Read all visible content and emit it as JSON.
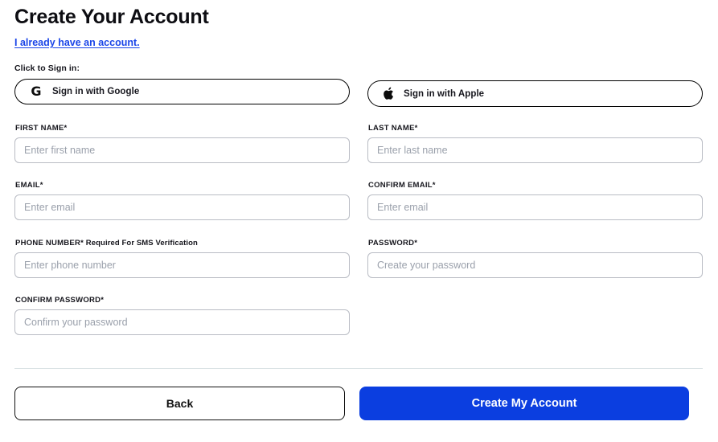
{
  "header": {
    "title": "Create Your Account",
    "existing_account_link": "I already have an account.",
    "signin_caption": "Click to Sign in:"
  },
  "social": {
    "google": {
      "label": "Sign in with Google",
      "icon": "google-g-icon",
      "glyph": "G"
    },
    "apple": {
      "label": "Sign in with Apple",
      "icon": "apple-logo-icon"
    }
  },
  "form": {
    "fields": [
      {
        "key": "first_name",
        "label": "FIRST NAME*",
        "note": "",
        "placeholder": "Enter first name",
        "value": "",
        "type": "text",
        "column": "left",
        "row": 1
      },
      {
        "key": "last_name",
        "label": "LAST NAME*",
        "note": "",
        "placeholder": "Enter last name",
        "value": "",
        "type": "text",
        "column": "right",
        "row": 1
      },
      {
        "key": "email",
        "label": "EMAIL*",
        "note": "",
        "placeholder": "Enter email",
        "value": "",
        "type": "text",
        "column": "left",
        "row": 2
      },
      {
        "key": "confirm_email",
        "label": "CONFIRM EMAIL*",
        "note": "",
        "placeholder": "Enter email",
        "value": "",
        "type": "text",
        "column": "right",
        "row": 2
      },
      {
        "key": "phone_number",
        "label": "PHONE NUMBER*",
        "note": " Required For SMS Verification",
        "placeholder": "Enter phone number",
        "value": "",
        "type": "text",
        "column": "left",
        "row": 3
      },
      {
        "key": "password",
        "label": "PASSWORD*",
        "note": "",
        "placeholder": "Create your password",
        "value": "",
        "type": "password",
        "column": "right",
        "row": 3
      },
      {
        "key": "confirm_password",
        "label": "CONFIRM PASSWORD*",
        "note": "",
        "placeholder": "Confirm your password",
        "value": "",
        "type": "password",
        "column": "left",
        "row": 4
      }
    ]
  },
  "footer": {
    "back_label": "Back",
    "submit_label": "Create My Account"
  },
  "colors": {
    "accent_blue": "#0b3ee0",
    "link_blue": "#1a45e8",
    "text_dark": "#16161d",
    "placeholder_gray": "#9aa0ab",
    "input_border": "#b9bcc4",
    "divider": "#d9e2e4"
  }
}
